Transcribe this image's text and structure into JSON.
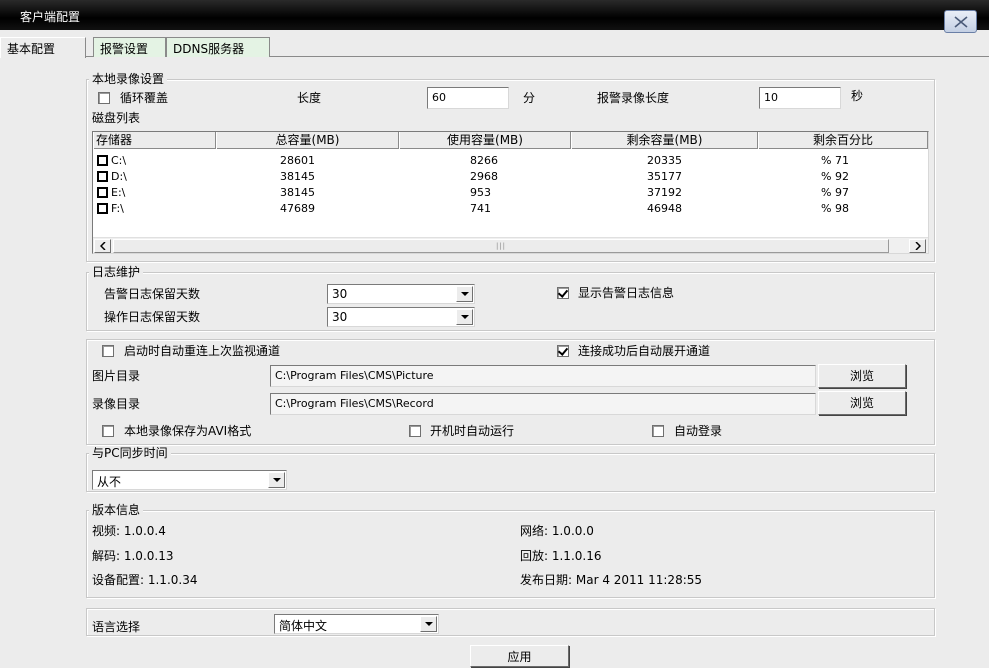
{
  "window": {
    "title": "客户端配置"
  },
  "tabs": [
    {
      "label": "基本配置"
    },
    {
      "label": "报警设置"
    },
    {
      "label": "DDNS服务器"
    }
  ],
  "local_record": {
    "legend": "本地录像设置",
    "loop_overwrite_label": "循环覆盖",
    "loop_overwrite_checked": false,
    "length_label": "长度",
    "length_value": "60",
    "length_unit": "分",
    "alarm_length_label": "报警录像长度",
    "alarm_length_value": "10",
    "alarm_length_unit": "秒",
    "disk_list_label": "磁盘列表",
    "columns": [
      "存储器",
      "总容量(MB)",
      "使用容量(MB)",
      "剩余容量(MB)",
      "剩余百分比"
    ],
    "rows": [
      {
        "drive": "C:\\",
        "total": "28601",
        "used": "8266",
        "free": "20335",
        "percent": "% 71"
      },
      {
        "drive": "D:\\",
        "total": "38145",
        "used": "2968",
        "free": "35177",
        "percent": "% 92"
      },
      {
        "drive": "E:\\",
        "total": "38145",
        "used": "953",
        "free": "37192",
        "percent": "% 97"
      },
      {
        "drive": "F:\\",
        "total": "47689",
        "used": "741",
        "free": "46948",
        "percent": "% 98"
      }
    ]
  },
  "log": {
    "legend": "日志维护",
    "alarm_days_label": "告警日志保留天数",
    "alarm_days_value": "30",
    "op_days_label": "操作日志保留天数",
    "op_days_value": "30",
    "show_alarm_label": "显示告警日志信息",
    "show_alarm_checked": true
  },
  "startup": {
    "auto_reconnect_label": "启动时自动重连上次监视通道",
    "auto_reconnect_checked": false,
    "auto_expand_label": "连接成功后自动展开通道",
    "auto_expand_checked": true,
    "picture_dir_label": "图片目录",
    "picture_dir_value": "C:\\Program Files\\CMS\\Picture",
    "record_dir_label": "录像目录",
    "record_dir_value": "C:\\Program Files\\CMS\\Record",
    "browse_label": "浏览",
    "save_avi_label": "本地录像保存为AVI格式",
    "save_avi_checked": false,
    "autorun_label": "开机时自动运行",
    "autorun_checked": false,
    "autologin_label": "自动登录",
    "autologin_checked": false
  },
  "sync": {
    "legend": "与PC同步时间",
    "value": "从不"
  },
  "version": {
    "legend": "版本信息",
    "video": "视频: 1.0.0.4",
    "network": "网络: 1.0.0.0",
    "decode": "解码: 1.0.0.13",
    "playback": "回放: 1.1.0.16",
    "device_config": "设备配置: 1.1.0.34",
    "release_date": "发布日期: Mar  4 2011 11:28:55"
  },
  "language": {
    "label": "语言选择",
    "value": "简体中文"
  },
  "apply_label": "应用"
}
